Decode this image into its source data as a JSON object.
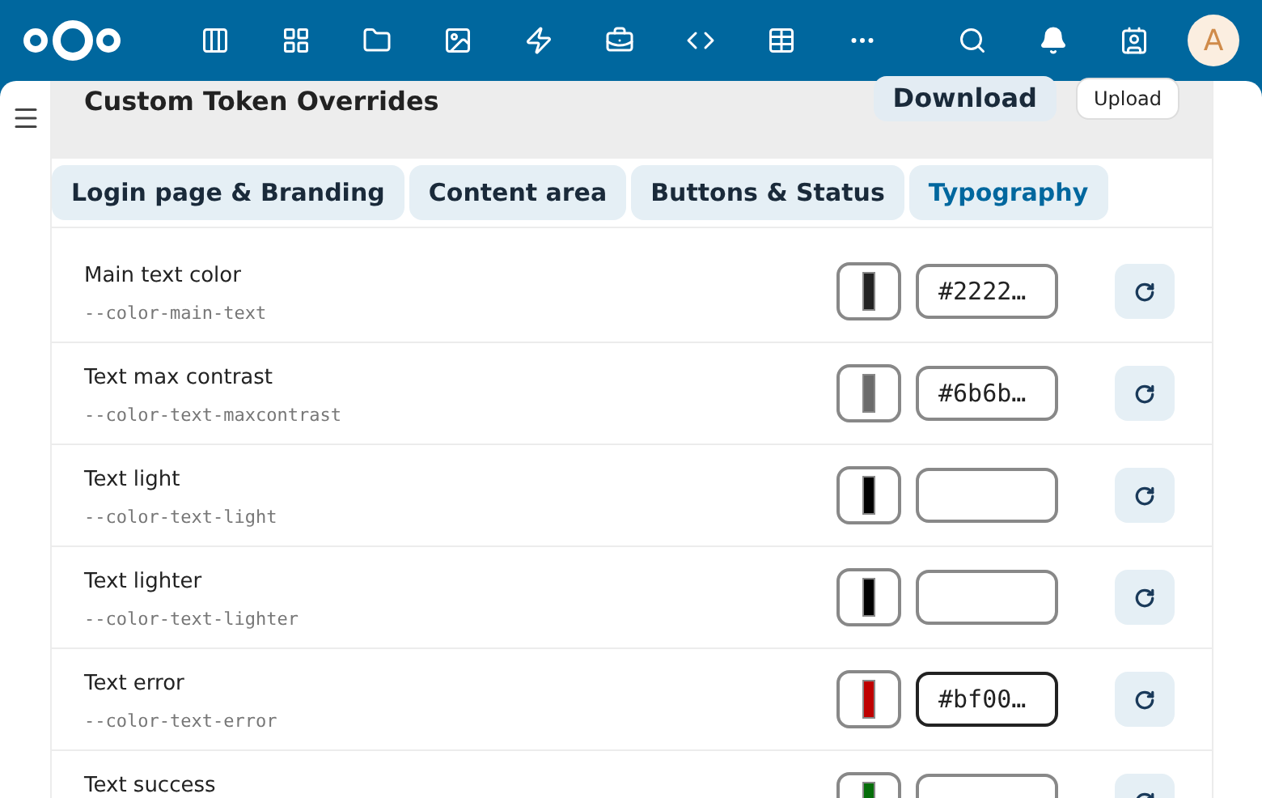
{
  "topbar": {
    "apps": [
      {
        "kind": "columns"
      },
      {
        "kind": "grid"
      },
      {
        "kind": "folder"
      },
      {
        "kind": "image"
      },
      {
        "kind": "bolt"
      },
      {
        "kind": "suitcase"
      },
      {
        "kind": "code"
      },
      {
        "kind": "table"
      },
      {
        "kind": "more"
      }
    ],
    "avatar": "A"
  },
  "header": {
    "title": "Custom Token Overrides",
    "download": "Download",
    "upload": "Upload"
  },
  "tabs": [
    {
      "label": "Login page & Branding",
      "selected": false
    },
    {
      "label": "Content area",
      "selected": false
    },
    {
      "label": "Buttons & Status",
      "selected": false
    },
    {
      "label": "Typography",
      "selected": true
    }
  ],
  "tokens": [
    {
      "label": "Main text color",
      "variable": "--color-main-text",
      "color": "#222222",
      "value": "#2222…",
      "focused": false
    },
    {
      "label": "Text max contrast",
      "variable": "--color-text-maxcontrast",
      "color": "#6b6b6b",
      "value": "#6b6b…",
      "focused": false
    },
    {
      "label": "Text light",
      "variable": "--color-text-light",
      "color": "#000000",
      "focused": false
    },
    {
      "label": "Text lighter",
      "variable": "--color-text-lighter",
      "color": "#000000",
      "focused": false
    },
    {
      "label": "Text error",
      "variable": "--color-text-error",
      "color": "#bf0000",
      "value": "#bf00…",
      "focused": true
    },
    {
      "label": "Text success",
      "color": "#066e0a",
      "focused": false
    }
  ]
}
